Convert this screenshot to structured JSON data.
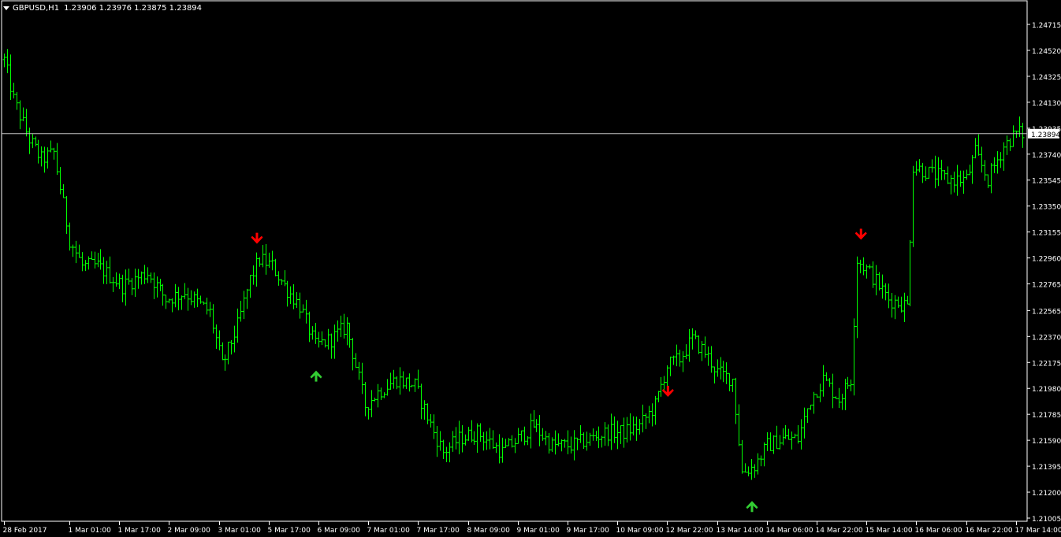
{
  "window": {
    "symbol": "GBPUSD,H1",
    "ohlc": "1.23906 1.23976 1.23875 1.23894"
  },
  "colors": {
    "background": "#000000",
    "bars": "#00ff00",
    "axis": "#ffffff",
    "price_line": "#c0c0c0",
    "sell_arrow": "#ff0000",
    "buy_arrow": "#32cd32"
  },
  "icons": {
    "sell_signal": "down-arrow-icon",
    "buy_signal": "up-arrow-icon"
  },
  "chart_data": {
    "type": "ohlc",
    "title": "GBPUSD,H1",
    "timeframe": "H1",
    "current_price": "1.23894",
    "ylim": [
      1.21005,
      1.2482
    ],
    "y_ticks": [
      "1.24715",
      "1.24520",
      "1.24325",
      "1.24130",
      "1.23935",
      "1.23740",
      "1.23545",
      "1.23350",
      "1.23155",
      "1.22960",
      "1.22765",
      "1.22565",
      "1.22370",
      "1.22175",
      "1.21980",
      "1.21785",
      "1.21590",
      "1.21395",
      "1.21200",
      "1.21005"
    ],
    "x_ticks": [
      {
        "label": "28 Feb 2017",
        "bar": 0
      },
      {
        "label": "1 Mar 01:00",
        "bar": 21
      },
      {
        "label": "1 Mar 17:00",
        "bar": 37
      },
      {
        "label": "2 Mar 09:00",
        "bar": 53
      },
      {
        "label": "3 Mar 01:00",
        "bar": 69
      },
      {
        "label": "5 Mar 17:00",
        "bar": 85
      },
      {
        "label": "6 Mar 09:00",
        "bar": 101
      },
      {
        "label": "7 Mar 01:00",
        "bar": 117
      },
      {
        "label": "7 Mar 17:00",
        "bar": 133
      },
      {
        "label": "8 Mar 09:00",
        "bar": 149
      },
      {
        "label": "9 Mar 01:00",
        "bar": 165
      },
      {
        "label": "9 Mar 17:00",
        "bar": 181
      },
      {
        "label": "10 Mar 09:00",
        "bar": 197
      },
      {
        "label": "12 Mar 22:00",
        "bar": 213
      },
      {
        "label": "13 Mar 14:00",
        "bar": 229
      },
      {
        "label": "14 Mar 06:00",
        "bar": 245
      },
      {
        "label": "14 Mar 22:00",
        "bar": 261
      },
      {
        "label": "15 Mar 14:00",
        "bar": 277
      },
      {
        "label": "16 Mar 06:00",
        "bar": 293
      },
      {
        "label": "16 Mar 22:00",
        "bar": 309
      },
      {
        "label": "17 Mar 14:00",
        "bar": 325
      }
    ],
    "bar_count": 330,
    "key_closes": [
      {
        "bar": 0,
        "close": 1.2445
      },
      {
        "bar": 3,
        "close": 1.2415
      },
      {
        "bar": 8,
        "close": 1.2385
      },
      {
        "bar": 12,
        "close": 1.237
      },
      {
        "bar": 16,
        "close": 1.2375
      },
      {
        "bar": 21,
        "close": 1.231
      },
      {
        "bar": 25,
        "close": 1.229
      },
      {
        "bar": 30,
        "close": 1.229
      },
      {
        "bar": 38,
        "close": 1.2275
      },
      {
        "bar": 46,
        "close": 1.2285
      },
      {
        "bar": 52,
        "close": 1.2265
      },
      {
        "bar": 58,
        "close": 1.227
      },
      {
        "bar": 66,
        "close": 1.2255
      },
      {
        "bar": 70,
        "close": 1.2215
      },
      {
        "bar": 75,
        "close": 1.2245
      },
      {
        "bar": 79,
        "close": 1.228
      },
      {
        "bar": 82,
        "close": 1.2295
      },
      {
        "bar": 86,
        "close": 1.229
      },
      {
        "bar": 90,
        "close": 1.2275
      },
      {
        "bar": 95,
        "close": 1.226
      },
      {
        "bar": 100,
        "close": 1.223
      },
      {
        "bar": 105,
        "close": 1.2235
      },
      {
        "bar": 110,
        "close": 1.2245
      },
      {
        "bar": 116,
        "close": 1.2185
      },
      {
        "bar": 120,
        "close": 1.2195
      },
      {
        "bar": 126,
        "close": 1.2205
      },
      {
        "bar": 132,
        "close": 1.22
      },
      {
        "bar": 138,
        "close": 1.2165
      },
      {
        "bar": 141,
        "close": 1.215
      },
      {
        "bar": 146,
        "close": 1.216
      },
      {
        "bar": 152,
        "close": 1.2165
      },
      {
        "bar": 160,
        "close": 1.215
      },
      {
        "bar": 165,
        "close": 1.216
      },
      {
        "bar": 170,
        "close": 1.217
      },
      {
        "bar": 176,
        "close": 1.2155
      },
      {
        "bar": 182,
        "close": 1.2155
      },
      {
        "bar": 188,
        "close": 1.216
      },
      {
        "bar": 194,
        "close": 1.2165
      },
      {
        "bar": 199,
        "close": 1.2165
      },
      {
        "bar": 204,
        "close": 1.217
      },
      {
        "bar": 209,
        "close": 1.2185
      },
      {
        "bar": 213,
        "close": 1.2215
      },
      {
        "bar": 217,
        "close": 1.222
      },
      {
        "bar": 221,
        "close": 1.2235
      },
      {
        "bar": 225,
        "close": 1.2225
      },
      {
        "bar": 229,
        "close": 1.221
      },
      {
        "bar": 234,
        "close": 1.2205
      },
      {
        "bar": 237,
        "close": 1.2135
      },
      {
        "bar": 241,
        "close": 1.214
      },
      {
        "bar": 245,
        "close": 1.2155
      },
      {
        "bar": 250,
        "close": 1.216
      },
      {
        "bar": 255,
        "close": 1.216
      },
      {
        "bar": 259,
        "close": 1.219
      },
      {
        "bar": 263,
        "close": 1.2205
      },
      {
        "bar": 268,
        "close": 1.219
      },
      {
        "bar": 272,
        "close": 1.2205
      },
      {
        "bar": 274,
        "close": 1.2295
      },
      {
        "bar": 278,
        "close": 1.2285
      },
      {
        "bar": 284,
        "close": 1.2265
      },
      {
        "bar": 290,
        "close": 1.226
      },
      {
        "bar": 292,
        "close": 1.2365
      },
      {
        "bar": 297,
        "close": 1.236
      },
      {
        "bar": 303,
        "close": 1.2355
      },
      {
        "bar": 309,
        "close": 1.2355
      },
      {
        "bar": 312,
        "close": 1.2375
      },
      {
        "bar": 316,
        "close": 1.2355
      },
      {
        "bar": 321,
        "close": 1.238
      },
      {
        "bar": 325,
        "close": 1.239
      },
      {
        "bar": 329,
        "close": 1.2389
      }
    ],
    "signals": [
      {
        "type": "sell",
        "bar": 81,
        "price": 1.2309
      },
      {
        "type": "buy",
        "bar": 100,
        "price": 1.2209
      },
      {
        "type": "sell",
        "bar": 213,
        "price": 1.2194
      },
      {
        "type": "buy",
        "bar": 240,
        "price": 1.2111
      },
      {
        "type": "sell",
        "bar": 275,
        "price": 1.2312
      }
    ],
    "grid": false,
    "legend": "none"
  }
}
